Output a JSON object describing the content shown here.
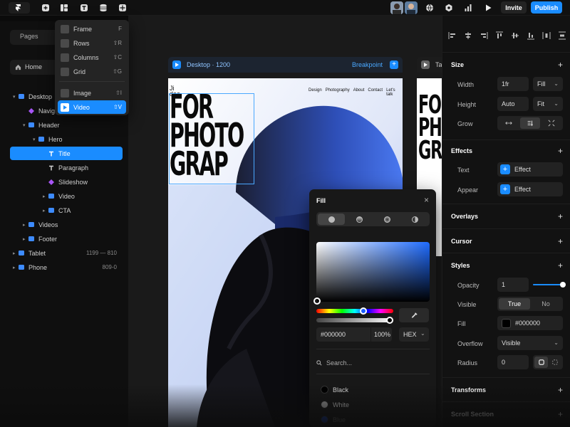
{
  "topbar": {
    "tools": [
      "logo-menu",
      "insert",
      "layout",
      "text",
      "cms",
      "assets"
    ],
    "invite_label": "Invite",
    "publish_label": "Publish"
  },
  "left": {
    "pages_tab": "Pages",
    "home_label": "Home",
    "layers": [
      {
        "label": "Desktop",
        "icon": "frame",
        "depth": 0,
        "caret": "▾"
      },
      {
        "label": "Navigation",
        "icon": "component",
        "depth": 1,
        "caret": ""
      },
      {
        "label": "Header",
        "icon": "stack",
        "depth": 1,
        "caret": "▾"
      },
      {
        "label": "Hero",
        "icon": "stack",
        "depth": 2,
        "caret": "▾"
      },
      {
        "label": "Title",
        "icon": "text",
        "depth": 3,
        "caret": "",
        "selected": true
      },
      {
        "label": "Paragraph",
        "icon": "text",
        "depth": 3,
        "caret": ""
      },
      {
        "label": "Slideshow",
        "icon": "component",
        "depth": 3,
        "caret": ""
      },
      {
        "label": "Video",
        "icon": "frame",
        "depth": 3,
        "caret": "▸"
      },
      {
        "label": "CTA",
        "icon": "frame",
        "depth": 3,
        "caret": "▸"
      },
      {
        "label": "Videos",
        "icon": "stack",
        "depth": 1,
        "caret": "▸"
      },
      {
        "label": "Footer",
        "icon": "stack",
        "depth": 1,
        "caret": "▸"
      },
      {
        "label": "Tablet",
        "icon": "frame",
        "depth": 0,
        "caret": "▸",
        "range": "1199 — 810"
      },
      {
        "label": "Phone",
        "icon": "frame",
        "depth": 0,
        "caret": "▸",
        "range": "809-0"
      }
    ]
  },
  "insert_menu": {
    "items": [
      {
        "label": "Frame",
        "shortcut": "F"
      },
      {
        "label": "Rows",
        "shortcut": "⇧R"
      },
      {
        "label": "Columns",
        "shortcut": "⇧C"
      },
      {
        "label": "Grid",
        "shortcut": "⇧G"
      },
      {
        "label": "Image",
        "shortcut": "⇧I"
      },
      {
        "label": "Video",
        "shortcut": "⇧V",
        "selected": true
      }
    ]
  },
  "canvas": {
    "frame_name": "Desktop · 1200",
    "breakpoint_label": "Breakpoint",
    "frame2_name": "Ta",
    "site": {
      "logo": "Ji\ndao",
      "nav": [
        "Design",
        "Photography",
        "About",
        "Contact",
        "Let's talk"
      ],
      "hero_lines": [
        "FOR",
        "PHOTO",
        "GRAP"
      ],
      "frame2_lines": [
        "FO",
        "PH",
        "GR"
      ]
    }
  },
  "fill": {
    "title": "Fill",
    "hex": "#000000",
    "opacity": "100%",
    "format": "HEX",
    "search_placeholder": "Search...",
    "swatches": [
      {
        "name": "Black",
        "color": "#000000"
      },
      {
        "name": "White",
        "color": "#ffffff"
      },
      {
        "name": "Blue",
        "color": "#1a56ff"
      }
    ]
  },
  "right": {
    "size": {
      "title": "Size",
      "width_label": "Width",
      "width_value": "1fr",
      "width_mode": "Fill",
      "height_label": "Height",
      "height_value": "Auto",
      "height_mode": "Fit",
      "grow_label": "Grow"
    },
    "effects": {
      "title": "Effects",
      "text_label": "Text",
      "text_btn": "Effect",
      "appear_label": "Appear",
      "appear_btn": "Effect"
    },
    "overlays_title": "Overlays",
    "cursor_title": "Cursor",
    "styles": {
      "title": "Styles",
      "opacity_label": "Opacity",
      "opacity_value": "1",
      "opacity_fraction": 1,
      "visible_label": "Visible",
      "visible_true": "True",
      "visible_false": "No",
      "fill_label": "Fill",
      "fill_value": "#000000",
      "overflow_label": "Overflow",
      "overflow_value": "Visible",
      "radius_label": "Radius",
      "radius_value": "0"
    },
    "transforms_title": "Transforms",
    "scroll_title": "Scroll Section"
  },
  "colors": {
    "accent": "#1a8cff",
    "panel": "#121212",
    "canvas": "#1a1a1a"
  }
}
